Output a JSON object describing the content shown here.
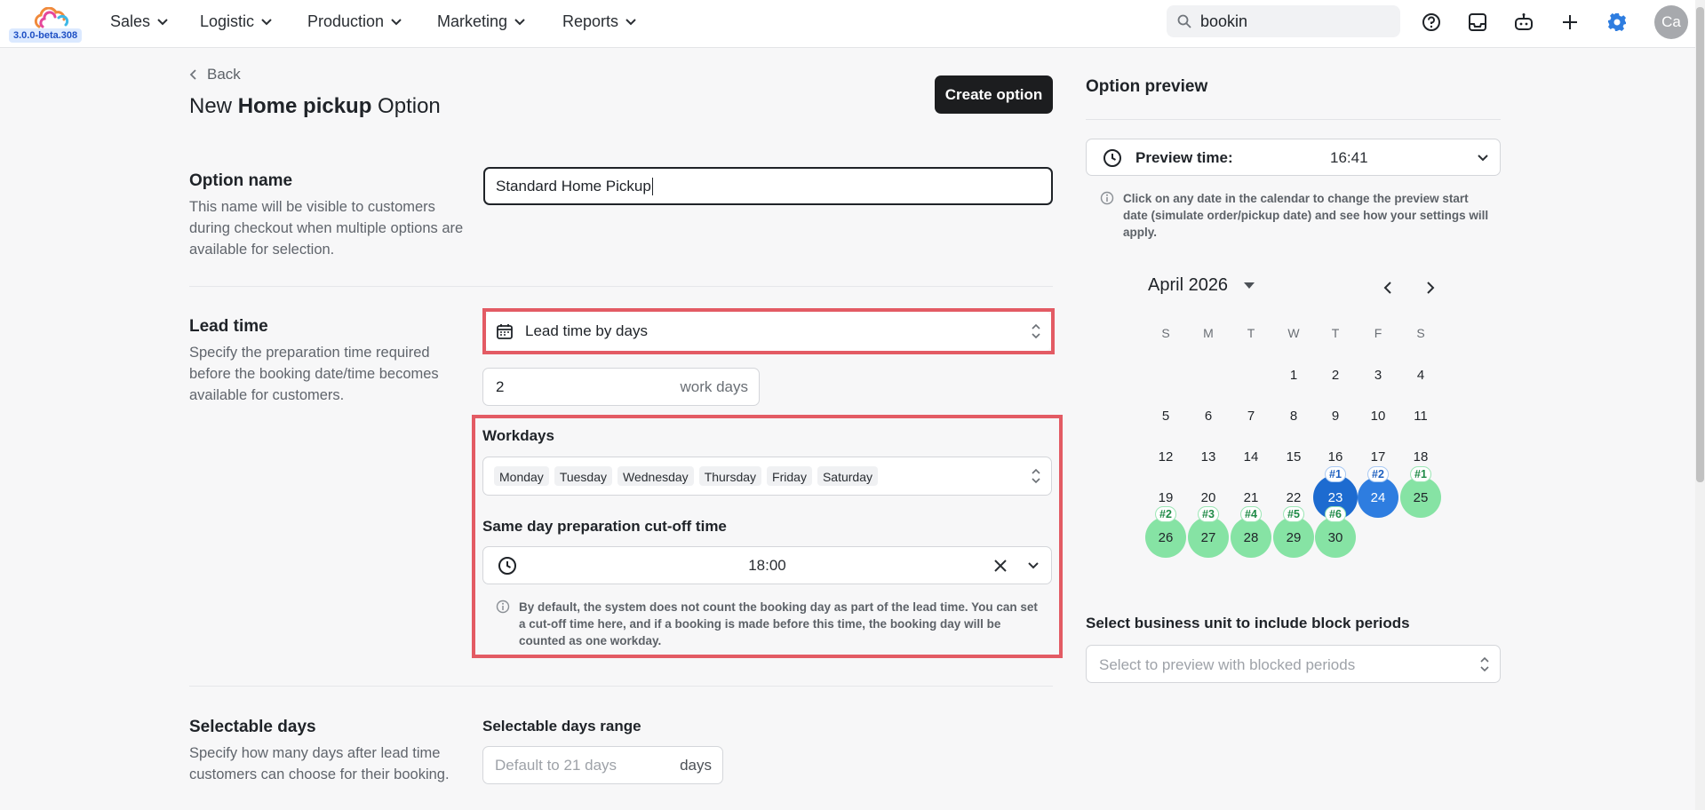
{
  "app": {
    "version": "3.0.0-beta.308"
  },
  "nav": [
    "Sales",
    "Logistic",
    "Production",
    "Marketing",
    "Reports"
  ],
  "search": {
    "value": "bookin"
  },
  "user": {
    "initials": "Ca"
  },
  "page": {
    "back_label": "Back",
    "title_prefix": "New ",
    "title_bold": "Home pickup",
    "title_suffix": " Option",
    "create_button": "Create option"
  },
  "option_name": {
    "title": "Option name",
    "description": "This name will be visible to customers during checkout when multiple options are available for selection.",
    "value": "Standard Home Pickup"
  },
  "lead_time": {
    "title": "Lead time",
    "description": "Specify the preparation time required before the booking date/time becomes available for customers.",
    "mode": "Lead time by days",
    "days_value": "2",
    "days_unit": "work days",
    "workdays_label": "Workdays",
    "workdays": [
      "Monday",
      "Tuesday",
      "Wednesday",
      "Thursday",
      "Friday",
      "Saturday"
    ],
    "cutoff_label": "Same day preparation cut-off time",
    "cutoff_value": "18:00",
    "cutoff_hint": "By default, the system does not count the booking day as part of the lead time. You can set a cut-off time here, and if a booking is made before this time, the booking day will be counted as one workday."
  },
  "selectable_days": {
    "title": "Selectable days",
    "description": "Specify how many days after lead time customers can choose for their booking.",
    "range_label": "Selectable days range",
    "placeholder": "Default to 21 days",
    "unit": "days"
  },
  "preview": {
    "title": "Option preview",
    "time_label": "Preview time:",
    "time_value": "16:41",
    "hint": "Click on any date in the calendar to change the preview start date (simulate order/pickup date) and see how your settings will apply.",
    "month": "April 2026",
    "weekdays": [
      "S",
      "M",
      "T",
      "W",
      "T",
      "F",
      "S"
    ],
    "first_weekday_index": 3,
    "days_in_month": 30,
    "selected_day": 23,
    "marked_days": [
      {
        "day": 23,
        "label": "#1",
        "color": "blue"
      },
      {
        "day": 24,
        "label": "#2",
        "color": "blue"
      },
      {
        "day": 25,
        "label": "#1",
        "color": "green"
      },
      {
        "day": 26,
        "label": "#2",
        "color": "green"
      },
      {
        "day": 27,
        "label": "#3",
        "color": "green"
      },
      {
        "day": 28,
        "label": "#4",
        "color": "green"
      },
      {
        "day": 29,
        "label": "#5",
        "color": "green"
      },
      {
        "day": 30,
        "label": "#6",
        "color": "green"
      }
    ],
    "business_unit_label": "Select business unit to include block periods",
    "business_unit_placeholder": "Select to preview with blocked periods"
  },
  "colors": {
    "highlight": "#e35b64",
    "green_day": "#86e3a4",
    "blue_day": "#2e7de0",
    "accent": "#2e7de0"
  }
}
